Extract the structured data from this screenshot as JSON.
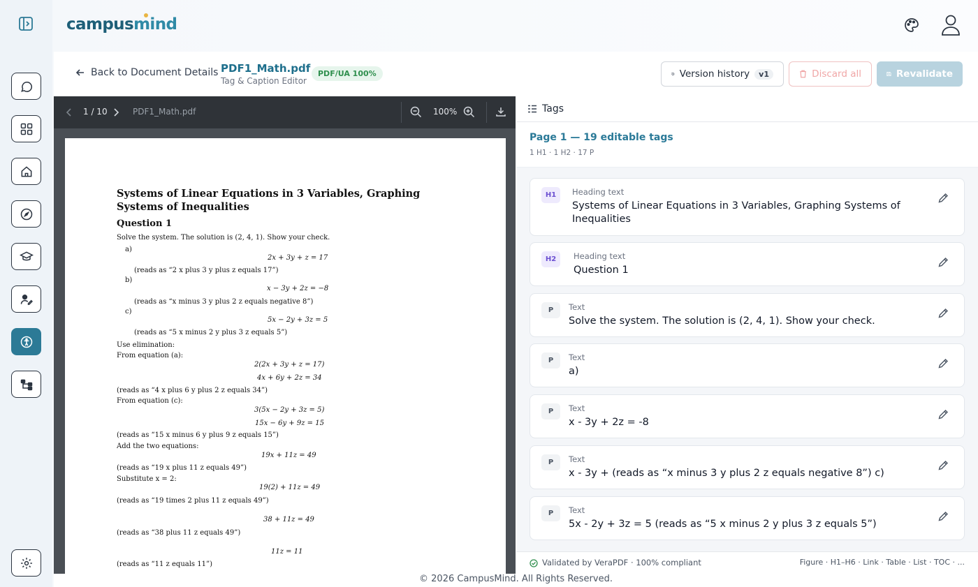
{
  "brand": {
    "part1": "campus",
    "part2": "mind"
  },
  "header": {
    "back_label": "Back to Document Details",
    "file_name": "PDF1_Math.pdf",
    "file_subtitle": "Tag & Caption Editor",
    "badge": "PDF/UA 100%",
    "version_history_label": "Version history",
    "version": "v1",
    "discard_label": "Discard all",
    "revalidate_label": "Revalidate"
  },
  "sidebar": {
    "items": [
      {
        "icon": "chat-icon"
      },
      {
        "icon": "grid-icon"
      },
      {
        "icon": "home-icon"
      },
      {
        "icon": "compass-icon"
      },
      {
        "icon": "graduation-cap-icon"
      },
      {
        "icon": "user-edit-icon"
      },
      {
        "icon": "accessibility-icon",
        "active": true
      },
      {
        "icon": "tree-icon"
      }
    ],
    "settings_icon": "gear-icon"
  },
  "viewer": {
    "page_indicator": "1 / 10",
    "file_name": "PDF1_Math.pdf",
    "zoom": "100%"
  },
  "pdf_page": {
    "title": "Systems of Linear Equations in 3 Variables, Graphing Systems of Inequalities",
    "question": "Question 1",
    "lines": [
      "Solve the system. The solution is (2, 4, 1). Show your check.",
      "a)",
      "2x + 3y + z = 17",
      "(reads as “2 x plus 3 y plus z equals 17”)",
      "b)",
      "x − 3y + 2z = −8",
      "(reads as “x minus 3 y plus 2 z equals negative 8”)",
      "c)",
      "5x − 2y + 3z = 5",
      "(reads as “5 x minus 2 y plus 3 z equals 5”)",
      "Use elimination:",
      "From equation (a):",
      "2(2x + 3y + z = 17)",
      "4x + 6y + 2z = 34",
      "(reads as “4 x plus 6 y plus 2 z equals 34”)",
      "From equation (c):",
      "3(5x − 2y + 3z = 5)",
      "15x − 6y + 9z = 15",
      "(reads as “15 x minus 6 y plus 9 z equals 15”)",
      "Add the two equations:",
      "19x + 11z = 49",
      "(reads as “19 x plus 11 z equals 49”)",
      "Substitute x = 2:",
      "19(2) + 11z = 49",
      "(reads as “19 times 2 plus 11 z equals 49”)",
      "38 + 11z = 49",
      "(reads as “38 plus 11 z equals 49”)",
      "11z = 11",
      "(reads as “11 z equals 11”)"
    ]
  },
  "tags_panel": {
    "title": "Tags",
    "page_heading": "Page 1 — 19 editable tags",
    "summary": "1 H1 · 1 H2 · 17 P",
    "cards": [
      {
        "tag": "H1",
        "label": "Heading text",
        "text": "Systems of Linear Equations in 3 Variables, Graphing Systems of Inequalities"
      },
      {
        "tag": "H2",
        "label": "Heading text",
        "text": "Question 1"
      },
      {
        "tag": "P",
        "label": "Text",
        "text": "Solve the system. The solution is (2, 4, 1). Show your check."
      },
      {
        "tag": "P",
        "label": "Text",
        "text": "a)"
      },
      {
        "tag": "P",
        "label": "Text",
        "text": "x - 3y + 2z = -8"
      },
      {
        "tag": "P",
        "label": "Text",
        "text": "x - 3y + (reads as “x minus 3 y plus 2 z equals negative 8”) c)"
      },
      {
        "tag": "P",
        "label": "Text",
        "text": "5x - 2y + 3z = 5 (reads as “5 x minus 2 y plus 3 z equals 5”)"
      }
    ],
    "footer_status": "Validated by VeraPDF · 100% compliant",
    "footer_types": "Figure · H1–H6 · Link · Table · List · TOC · ..."
  },
  "footer": {
    "copyright": "© 2026 CampusMind. All Rights Reserved."
  },
  "colors": {
    "accent": "#2c7a96",
    "success": "#2f8f4e",
    "danger": "#f0a6a6"
  }
}
